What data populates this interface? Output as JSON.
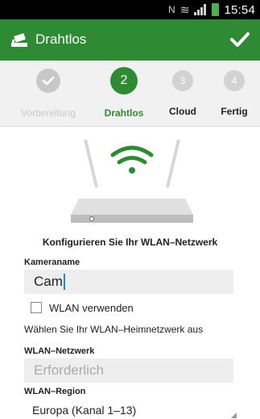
{
  "status_bar": {
    "time": "15:54"
  },
  "appbar": {
    "title": "Drahtlos"
  },
  "steps": [
    {
      "number": "1",
      "label": "Vorbereitung",
      "state": "done"
    },
    {
      "number": "2",
      "label": "Drahtlos",
      "state": "active"
    },
    {
      "number": "3",
      "label": "Cloud",
      "state": "todo"
    },
    {
      "number": "4",
      "label": "Fertig",
      "state": "todo"
    }
  ],
  "instruction": "Konfigurieren Sie Ihr WLAN–Netzwerk",
  "form": {
    "camera_name_label": "Kameraname",
    "camera_name_value": "Cam",
    "use_wlan_label": "WLAN verwenden",
    "hint": "Wählen Sie Ihr WLAN–Heimnetzwerk aus",
    "network_label": "WLAN–Netzwerk",
    "network_placeholder": "Erforderlich",
    "region_label": "WLAN–Region",
    "region_value": "Europa (Kanal 1–13)"
  },
  "colors": {
    "brand_green": "#2e8b33",
    "stepper_bg": "#f1f1f1"
  }
}
